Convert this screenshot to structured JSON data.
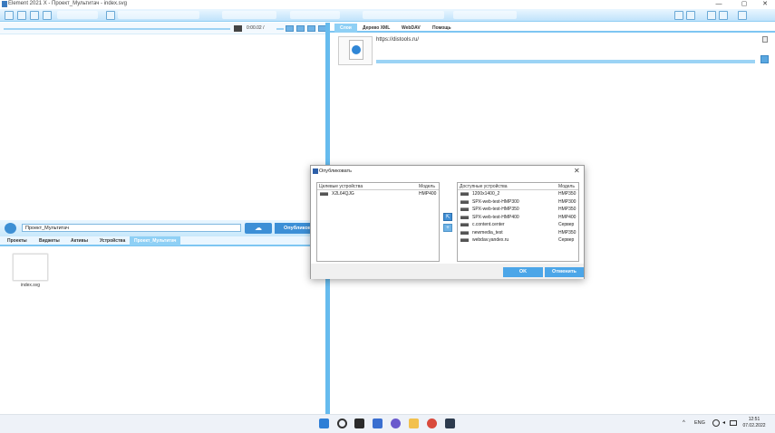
{
  "window": {
    "title": "Element 2021 X - Проект_Мультитач - index.svg",
    "minimize": "—",
    "maximize": "▢",
    "close": "✕"
  },
  "player": {
    "time": "0:00.02 /"
  },
  "right_tabs": [
    "Слои",
    "Дерево XML",
    "WebDAV",
    "Помощь"
  ],
  "right_panel": {
    "url": "https://distools.ru/"
  },
  "left_panel": {
    "project_name": "Проект_Мультитач",
    "publish_label": "Опубликовать",
    "tabs": [
      "Проекты",
      "Виджеты",
      "Активы",
      "Устройства",
      "Проект_Мультитач"
    ],
    "file": {
      "name": "index.svg"
    }
  },
  "dialog": {
    "title": "Опубликовать",
    "target": {
      "headers": [
        "Целевые устройства",
        "Модель"
      ],
      "rows": [
        {
          "name": "X2L64QJG",
          "model": "HMP400"
        }
      ]
    },
    "available": {
      "headers": [
        "Доступные устройства",
        "Модель"
      ],
      "rows": [
        {
          "name": "1200x1400_2",
          "model": "HMP350"
        },
        {
          "name": "SPX-web-test-HMP300",
          "model": "HMP300"
        },
        {
          "name": "SPX-web-test-HMP350",
          "model": "HMP350"
        },
        {
          "name": "SPX-web-test-HMP400",
          "model": "HMP400"
        },
        {
          "name": "c.content.center",
          "model": "Сервер"
        },
        {
          "name": "newmedia_test",
          "model": "HMP350"
        },
        {
          "name": "webdav.yandex.ru",
          "model": "Сервер"
        }
      ]
    },
    "ok": "OK",
    "cancel": "Отменить"
  },
  "taskbar": {
    "lang": "ENG",
    "time": "12:51",
    "date": "07.02.2022"
  }
}
